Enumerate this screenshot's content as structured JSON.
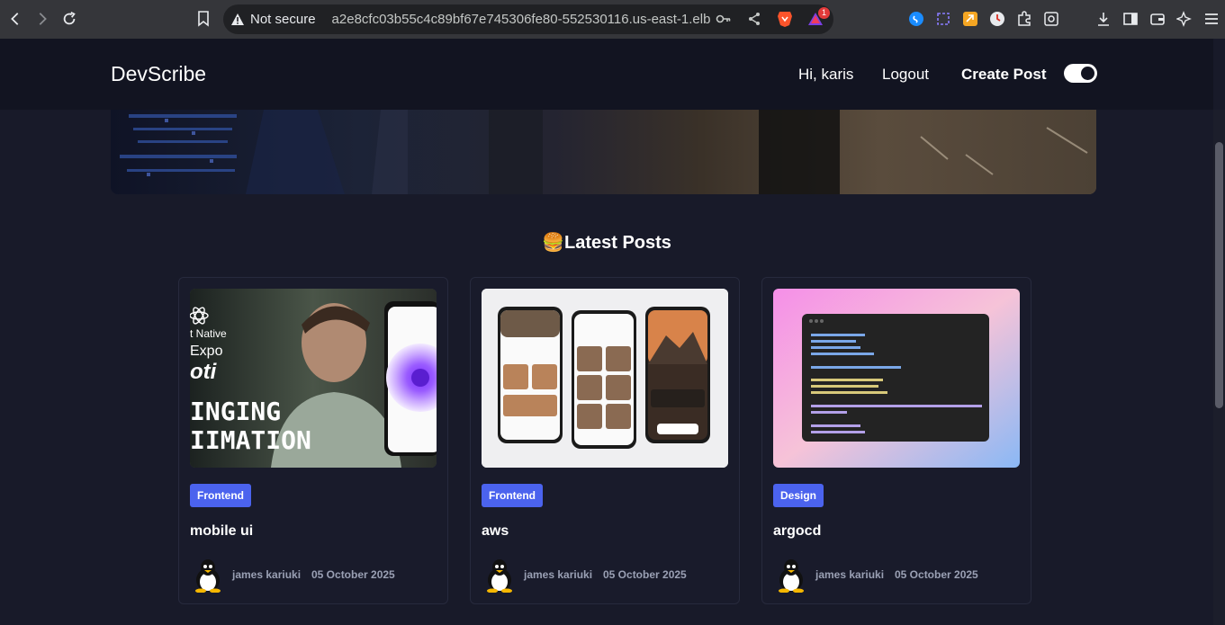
{
  "browser": {
    "security_label": "Not secure",
    "url": "a2e8cfc03b55c4c89bf67e745306fe80-552530116.us-east-1.elb...",
    "brave_badge": "1"
  },
  "header": {
    "brand": "DevScribe",
    "greeting": "Hi, karis",
    "logout": "Logout",
    "create_post": "Create Post",
    "theme_toggle_on": true
  },
  "section": {
    "title": "🍔Latest Posts"
  },
  "posts": [
    {
      "tag": "Frontend",
      "title": "mobile ui",
      "author": "james kariuki",
      "date": "05 October 2025",
      "thumb_text": [
        "t Native",
        "Expo",
        "oti",
        "INGING",
        "IIMATION"
      ]
    },
    {
      "tag": "Frontend",
      "title": "aws",
      "author": "james kariuki",
      "date": "05 October 2025"
    },
    {
      "tag": "Design",
      "title": "argocd",
      "author": "james kariuki",
      "date": "05 October 2025"
    }
  ],
  "colors": {
    "page_bg": "#181a29",
    "header_bg": "#121421",
    "tag_bg": "#4b63ee",
    "meta_text": "#9aa0b4"
  }
}
